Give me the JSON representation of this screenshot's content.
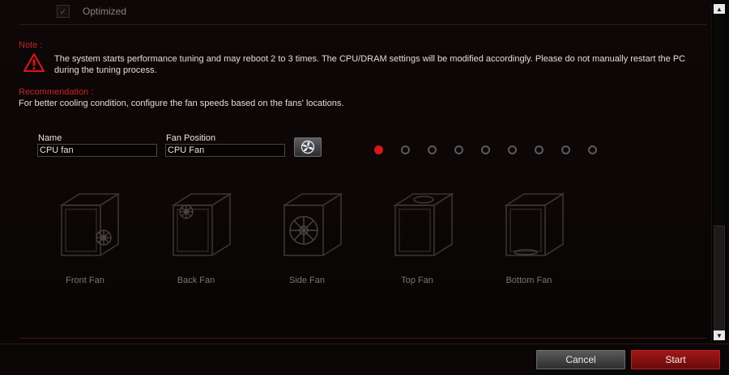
{
  "optimized": {
    "label": "Optimized",
    "checked": true
  },
  "note": {
    "heading": "Note :",
    "text": "The system starts performance tuning and may reboot 2 to 3 times. The CPU/DRAM settings will be modified accordingly. Please do not manually restart the PC during the tuning process.",
    "icon": "warning-icon"
  },
  "recommendation": {
    "heading": "Recommendation :",
    "text": "For better cooling condition, configure the fan speeds based on the fans' locations."
  },
  "fields": {
    "name_label": "Name",
    "name_value": "CPU fan",
    "position_label": "Fan Position",
    "position_value": "CPU Fan",
    "fan_button_icon": "fan-icon"
  },
  "pager": {
    "total": 9,
    "active_index": 0
  },
  "positions": [
    {
      "label": "Front Fan"
    },
    {
      "label": "Back Fan"
    },
    {
      "label": "Side Fan"
    },
    {
      "label": "Top Fan"
    },
    {
      "label": "Bottom Fan"
    }
  ],
  "buttons": {
    "cancel": "Cancel",
    "start": "Start"
  },
  "colors": {
    "accent_red": "#d8161b",
    "note_red": "#c42525",
    "background": "#0b0606"
  }
}
